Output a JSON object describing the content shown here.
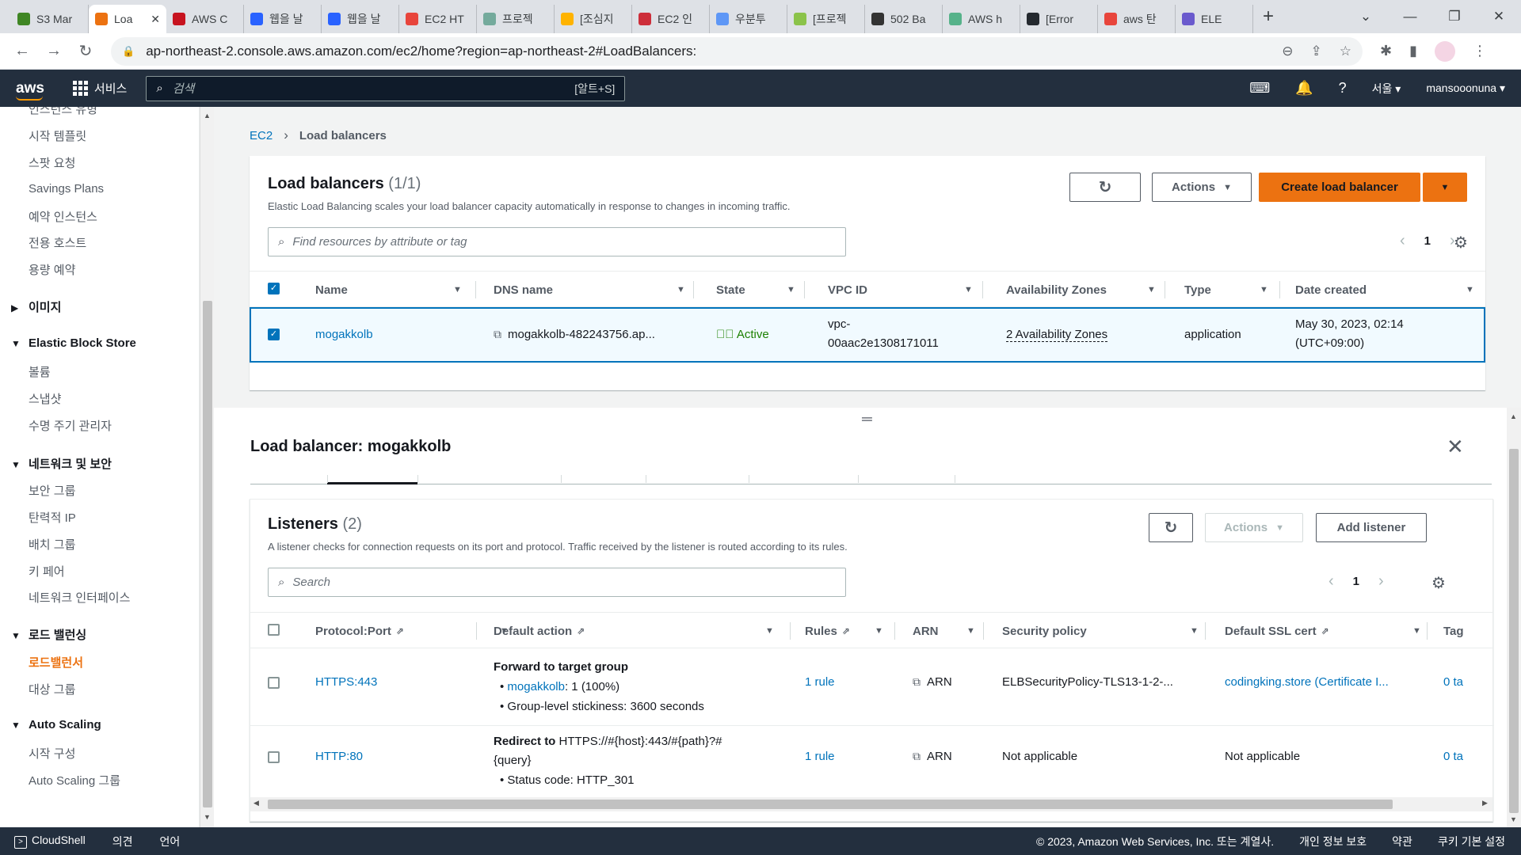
{
  "browser": {
    "tabs": [
      {
        "label": "S3 Mar",
        "color": "#3f8624"
      },
      {
        "label": "Loa",
        "color": "#ec7211",
        "active": true
      },
      {
        "label": "AWS C",
        "color": "#c7131f"
      },
      {
        "label": "웹을 날",
        "color": "#2962ff"
      },
      {
        "label": "웹을 날",
        "color": "#2962ff"
      },
      {
        "label": "EC2 HT",
        "color": "#e8453c"
      },
      {
        "label": "프로젝",
        "color": "#74aa9c"
      },
      {
        "label": "[조심지",
        "color": "#ffb300"
      },
      {
        "label": "EC2 인",
        "color": "#cd2e3a"
      },
      {
        "label": "우분투",
        "color": "#5e97f6"
      },
      {
        "label": "[프로젝",
        "color": "#8bc34a"
      },
      {
        "label": "502 Ba",
        "color": "#333333"
      },
      {
        "label": "AWS h",
        "color": "#56b28a"
      },
      {
        "label": "[Error ",
        "color": "#24292f"
      },
      {
        "label": "aws 탄",
        "color": "#e8453c"
      },
      {
        "label": "ELE",
        "color": "#6a5acd"
      }
    ],
    "url": "ap-northeast-2.console.aws.amazon.com/ec2/home?region=ap-northeast-2#LoadBalancers:"
  },
  "awsbar": {
    "logo": "aws",
    "services": "서비스",
    "search_placeholder": "검색",
    "search_shortcut": "[알트+S]",
    "region": "서울 ▾",
    "user": "mansooonuna ▾"
  },
  "sidebar": {
    "partial_top": "인스턴스 유형",
    "items_top": [
      "시작 템플릿",
      "스팟 요청",
      "Savings Plans",
      "예약 인스턴스",
      "전용 호스트",
      "용량 예약"
    ],
    "sec_images": "이미지",
    "sec_ebs": "Elastic Block Store",
    "ebs_items": [
      "볼륨",
      "스냅샷",
      "수명 주기 관리자"
    ],
    "sec_network": "네트워크 및 보안",
    "network_items": [
      "보안 그룹",
      "탄력적 IP",
      "배치 그룹",
      "키 페어",
      "네트워크 인터페이스"
    ],
    "sec_lb": "로드 밸런싱",
    "lb_items": [
      "로드밸런서",
      "대상 그룹"
    ],
    "sec_autoscaling": "Auto Scaling",
    "as_items": [
      "시작 구성",
      "Auto Scaling 그룹"
    ]
  },
  "breadcrumb": {
    "root": "EC2",
    "current": "Load balancers"
  },
  "lb_panel": {
    "title": "Load balancers",
    "count": "(1/1)",
    "description": "Elastic Load Balancing scales your load balancer capacity automatically in response to changes in incoming traffic.",
    "actions_label": "Actions",
    "create_label": "Create load balancer",
    "filter_placeholder": "Find resources by attribute or tag",
    "page": "1",
    "columns": [
      "Name",
      "DNS name",
      "State",
      "VPC ID",
      "Availability Zones",
      "Type",
      "Date created"
    ],
    "row": {
      "name": "mogakkolb",
      "dns": "mogakkolb-482243756.ap...",
      "state": "Active",
      "vpc_line1": "vpc-",
      "vpc_line2": "00aac2e1308171011",
      "azs": "2 Availability Zones",
      "type": "application",
      "date_line1": "May 30, 2023, 02:14",
      "date_line2": "(UTC+09:00)"
    }
  },
  "detail": {
    "title": "Load balancer: mogakkolb"
  },
  "listeners": {
    "title": "Listeners",
    "count": "(2)",
    "description": "A listener checks for connection requests on its port and protocol. Traffic received by the listener is routed according to its rules.",
    "actions_label": "Actions",
    "add_label": "Add listener",
    "search_placeholder": "Search",
    "page": "1",
    "columns": [
      "Protocol:Port",
      "Default action",
      "Rules",
      "ARN",
      "Security policy",
      "Default SSL cert",
      "Tag"
    ],
    "rows": [
      {
        "protocol": "HTTPS:443",
        "action_title": "Forward to target group",
        "target_link": "mogakkolb",
        "target_rest": ": 1 (100%)",
        "stickiness": "Group-level stickiness: 3600 seconds",
        "rules": "1 rule",
        "arn": "ARN",
        "policy": "ELBSecurityPolicy-TLS13-1-2-...",
        "cert": "codingking.store (Certificate I...",
        "tags": "0 ta"
      },
      {
        "protocol": "HTTP:80",
        "action_title": "Redirect to",
        "redirect_target": "HTTPS://#{host}:443/#{path}?#",
        "redirect_target2": "{query}",
        "status_code": "Status code: HTTP_301",
        "rules": "1 rule",
        "arn": "ARN",
        "policy": "Not applicable",
        "cert": "Not applicable",
        "tags": "0 ta"
      }
    ]
  },
  "footer": {
    "cloudshell": "CloudShell",
    "feedback": "의견",
    "language": "언어",
    "copyright": "© 2023, Amazon Web Services, Inc. 또는 계열사.",
    "privacy": "개인 정보 보호",
    "terms": "약관",
    "cookies": "쿠키 기본 설정"
  }
}
